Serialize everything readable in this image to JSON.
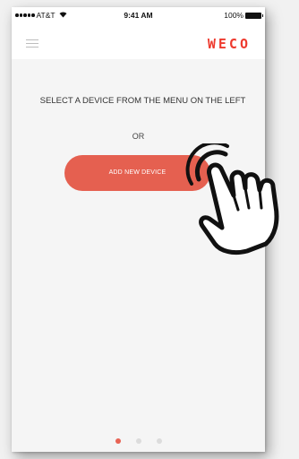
{
  "status_bar": {
    "carrier": "AT&T",
    "time": "9:41 AM",
    "battery": "100%"
  },
  "header": {
    "logo": "WECO"
  },
  "main": {
    "prompt": "SELECT A DEVICE FROM THE MENU ON THE LEFT",
    "or_label": "OR",
    "add_button_label": "ADD NEW DEVICE"
  },
  "pager": {
    "pages": 3,
    "active_index": 0
  },
  "colors": {
    "accent": "#e56050",
    "logo": "#ee3a2e"
  },
  "icons": [
    "signal-dots-icon",
    "wifi-icon",
    "battery-icon",
    "menu-icon",
    "pointing-hand-icon"
  ]
}
